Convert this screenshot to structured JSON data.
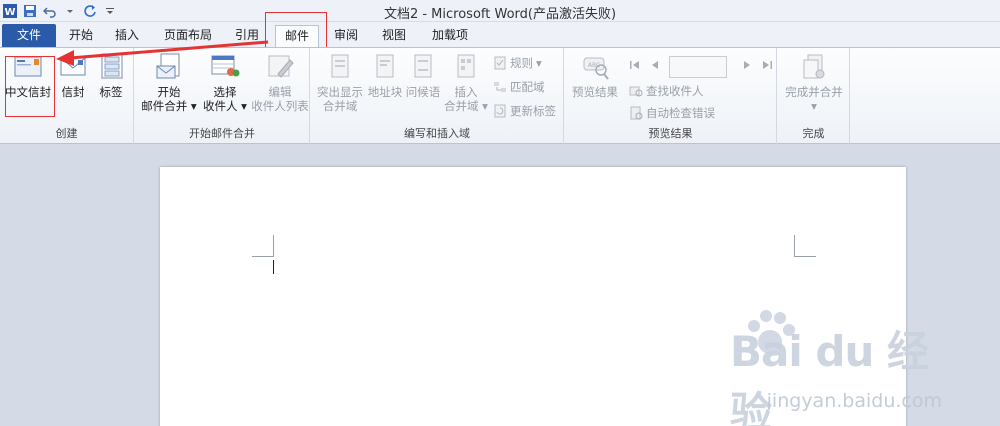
{
  "window": {
    "title": "文档2 - Microsoft Word(产品激活失败)"
  },
  "tabs": [
    {
      "label": "文件"
    },
    {
      "label": "开始"
    },
    {
      "label": "插入"
    },
    {
      "label": "页面布局"
    },
    {
      "label": "引用"
    },
    {
      "label": "邮件"
    },
    {
      "label": "审阅"
    },
    {
      "label": "视图"
    },
    {
      "label": "加载项"
    }
  ],
  "ribbon": {
    "create": {
      "label": "创建",
      "buttons": [
        "中文信封",
        "信封",
        "标签"
      ]
    },
    "start_merge": {
      "label": "开始邮件合并",
      "start_line1": "开始",
      "start_line2": "邮件合并",
      "select_line1": "选择",
      "select_line2": "收件人",
      "edit_line1": "编辑",
      "edit_line2": "收件人列表"
    },
    "write_insert": {
      "label": "编写和插入域",
      "highlight_line1": "突出显示",
      "highlight_line2": "合并域",
      "address": "地址块",
      "greeting": "问候语",
      "insert_line1": "插入",
      "insert_line2": "合并域",
      "rules": "规则",
      "match": "匹配域",
      "update": "更新标签"
    },
    "preview": {
      "label": "预览结果",
      "preview_btn": "预览结果",
      "find": "查找收件人",
      "auto_check": "自动检查错误"
    },
    "finish": {
      "label": "完成",
      "finish_btn": "完成并合并"
    }
  },
  "watermark": {
    "main": "Bai du 经验",
    "sub": "jingyan.baidu.com"
  }
}
